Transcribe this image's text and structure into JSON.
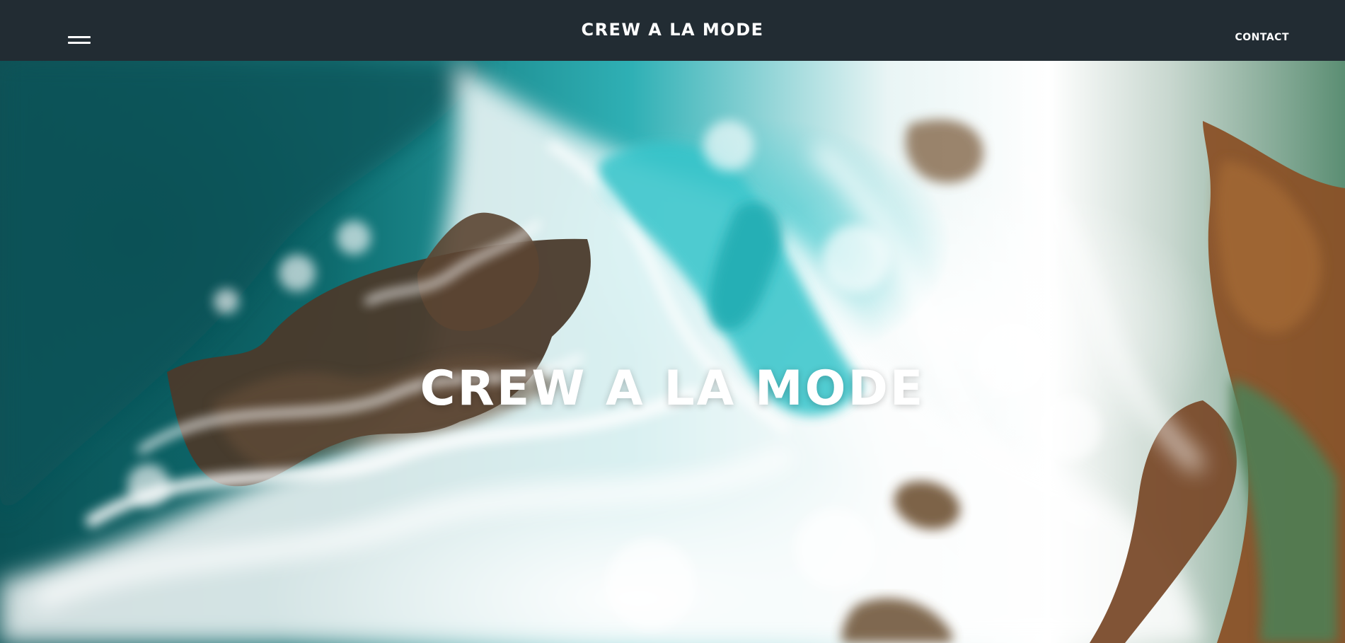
{
  "header": {
    "brand": "CREW A LA MODE",
    "contact_label": "CONTACT",
    "menu_icon": "menu-icon"
  },
  "hero": {
    "title": "CREW A LA MODE",
    "image": "ocean-waves-rocks-image"
  },
  "colors": {
    "header_bg": "#222c33",
    "header_text": "#ffffff",
    "ocean_dark": "#0a5256",
    "ocean_light": "#2fb0b5",
    "foam": "#ffffff",
    "rock": "#7a4b2b"
  }
}
